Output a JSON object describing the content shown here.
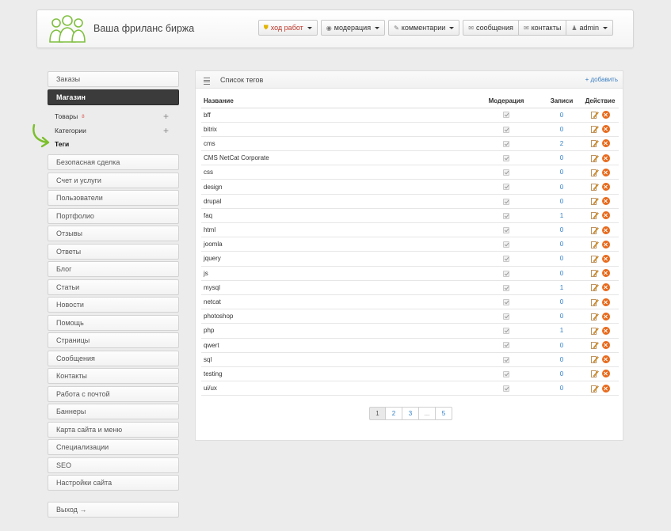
{
  "header": {
    "site_title": "Ваша фриланс биржа",
    "nav": [
      {
        "label": "ход работ",
        "icon": "shield-icon"
      },
      {
        "label": "модерация",
        "icon": "eye-icon"
      },
      {
        "label": "комментарии",
        "icon": "pencil-icon"
      },
      {
        "label": "сообщения",
        "icon": "envelope-icon"
      },
      {
        "label": "контакты",
        "icon": "envelope-icon"
      },
      {
        "label": "admin",
        "icon": "user-icon"
      }
    ]
  },
  "sidebar": {
    "top_items": [
      "Заказы",
      "Магазин"
    ],
    "sub_items": [
      {
        "label": "Товары",
        "badge": "8"
      },
      {
        "label": "Категории"
      },
      {
        "label": "Теги"
      }
    ],
    "items": [
      "Безопасная сделка",
      "Счет и услуги",
      "Пользователи",
      "Портфолио",
      "Отзывы",
      "Ответы",
      "Блог",
      "Статьи",
      "Новости",
      "Помощь",
      "Страницы",
      "Сообщения",
      "Контакты",
      "Работа с почтой",
      "Баннеры",
      "Карта сайта и меню",
      "Специализации",
      "SEO",
      "Настройки сайта"
    ],
    "logout": "Выход →"
  },
  "panel": {
    "title": "Список тегов",
    "add_link": "+ добавить",
    "columns": [
      "Название",
      "Модерация",
      "Записи",
      "Действие"
    ],
    "rows": [
      {
        "name": "bff",
        "count": "0"
      },
      {
        "name": "bitrix",
        "count": "0"
      },
      {
        "name": "cms",
        "count": "2"
      },
      {
        "name": "CMS NetCat Corporate",
        "count": "0"
      },
      {
        "name": "css",
        "count": "0"
      },
      {
        "name": "design",
        "count": "0"
      },
      {
        "name": "drupal",
        "count": "0"
      },
      {
        "name": "faq",
        "count": "1"
      },
      {
        "name": "html",
        "count": "0"
      },
      {
        "name": "joomla",
        "count": "0"
      },
      {
        "name": "jquery",
        "count": "0"
      },
      {
        "name": "js",
        "count": "0"
      },
      {
        "name": "mysql",
        "count": "1"
      },
      {
        "name": "netcat",
        "count": "0"
      },
      {
        "name": "photoshop",
        "count": "0"
      },
      {
        "name": "php",
        "count": "1"
      },
      {
        "name": "qwert",
        "count": "0"
      },
      {
        "name": "sql",
        "count": "0"
      },
      {
        "name": "testing",
        "count": "0"
      },
      {
        "name": "ui/ux",
        "count": "0"
      }
    ],
    "pagination": [
      "1",
      "2",
      "3",
      "...",
      "5"
    ]
  },
  "colors": {
    "accent": "#2f7fc6",
    "delete": "#e86a1c",
    "active_nav": "#3b3b3b"
  }
}
